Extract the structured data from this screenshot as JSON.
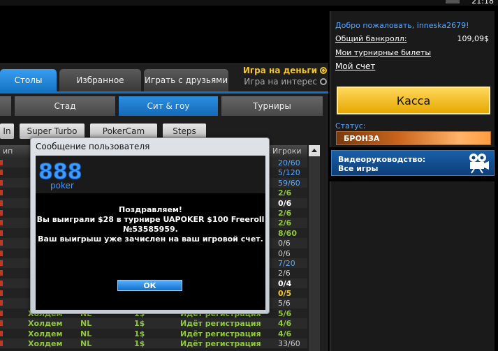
{
  "clock": "21:18",
  "money_options": [
    {
      "label": "Игра на деньги",
      "active": true
    },
    {
      "label": "Игра на интерес",
      "active": false
    }
  ],
  "tabs": [
    "Столы",
    "Избранное",
    "Играть с друзьями"
  ],
  "subtabs": [
    "",
    "Стад",
    "Сит & гоу",
    "Турниры"
  ],
  "filters": [
    "In",
    "Super Turbo",
    "PokerCam",
    "Steps"
  ],
  "table_headers": {
    "name": "ип",
    "players": "Игроки"
  },
  "rows": [
    {
      "game": "",
      "limit": "",
      "buyin": "",
      "status": "",
      "players": "20/60",
      "pl_class": "pl-blue"
    },
    {
      "game": "",
      "limit": "",
      "buyin": "",
      "status": "",
      "players": "5/120",
      "pl_class": "pl-blue"
    },
    {
      "game": "",
      "limit": "",
      "buyin": "",
      "status": "",
      "players": "59/60",
      "pl_class": "pl-blue"
    },
    {
      "game": "",
      "limit": "",
      "buyin": "",
      "status": "",
      "players": "2/6",
      "pl_class": "pl-green"
    },
    {
      "game": "",
      "limit": "",
      "buyin": "",
      "status": "",
      "players": "0/6",
      "pl_class": "pl-white"
    },
    {
      "game": "",
      "limit": "",
      "buyin": "",
      "status": "",
      "players": "2/6",
      "pl_class": "pl-green"
    },
    {
      "game": "",
      "limit": "",
      "buyin": "",
      "status": "",
      "players": "2/6",
      "pl_class": "pl-green"
    },
    {
      "game": "",
      "limit": "",
      "buyin": "",
      "status": "",
      "players": "8/60",
      "pl_class": "pl-green"
    },
    {
      "game": "",
      "limit": "",
      "buyin": "",
      "status": "",
      "players": "0/6",
      "pl_class": "pl-grey"
    },
    {
      "game": "",
      "limit": "",
      "buyin": "",
      "status": "",
      "players": "0/6",
      "pl_class": "pl-grey"
    },
    {
      "game": "",
      "limit": "",
      "buyin": "",
      "status": "",
      "players": "7/20",
      "pl_class": "pl-blue"
    },
    {
      "game": "",
      "limit": "",
      "buyin": "",
      "status": "",
      "players": "2/6",
      "pl_class": "pl-grey"
    },
    {
      "game": "",
      "limit": "",
      "buyin": "",
      "status": "",
      "players": "0/4",
      "pl_class": "pl-white"
    },
    {
      "game": "",
      "limit": "",
      "buyin": "",
      "status": "",
      "players": "0/5",
      "pl_class": "pl-gold"
    },
    {
      "game": "",
      "limit": "",
      "buyin": "",
      "status": "",
      "players": "5/6",
      "pl_class": "pl-grey"
    },
    {
      "game": "Холдем",
      "limit": "NL",
      "buyin": "1$",
      "status": "Идёт регистрация",
      "players": "5/6",
      "pl_class": "pl-green"
    },
    {
      "game": "Холдем",
      "limit": "NL",
      "buyin": "1$",
      "status": "Идёт регистрация",
      "players": "4/6",
      "pl_class": "pl-green"
    },
    {
      "game": "Холдем",
      "limit": "NL",
      "buyin": "1$",
      "status": "Идёт регистрация",
      "players": "4/6",
      "pl_class": "pl-green"
    },
    {
      "game": "Холдем",
      "limit": "NL",
      "buyin": "1$",
      "status": "Идёт регистрация",
      "players": "33/60",
      "pl_class": "pl-grey"
    }
  ],
  "dialog": {
    "title": "Сообщение пользователя",
    "logo_digits": "888",
    "logo_word": "poker",
    "lines": [
      "Поздравляем!",
      "Вы выиграли $28 в турнире UAPOKER $100 Freeroll",
      "№53585959.",
      "Ваш выигрыш уже зачислен на ваш игровой счет."
    ],
    "ok": "ОК"
  },
  "account": {
    "welcome": "Добро пожаловать, inneska2679!",
    "bankroll_label": "Общий банкролл:",
    "bankroll_value": "109,09$",
    "tickets": "Мои турнирные билеты",
    "my_account": "Мой счет",
    "cashier": "Касса",
    "status_label": "Статус:",
    "status_value": "БРОНЗА",
    "video_line1": "Видеоруководство:",
    "video_line2": "Все игры"
  },
  "colors": {
    "accent_blue": "#1574c4",
    "gold": "#f4c430",
    "green": "#8fc83a"
  }
}
